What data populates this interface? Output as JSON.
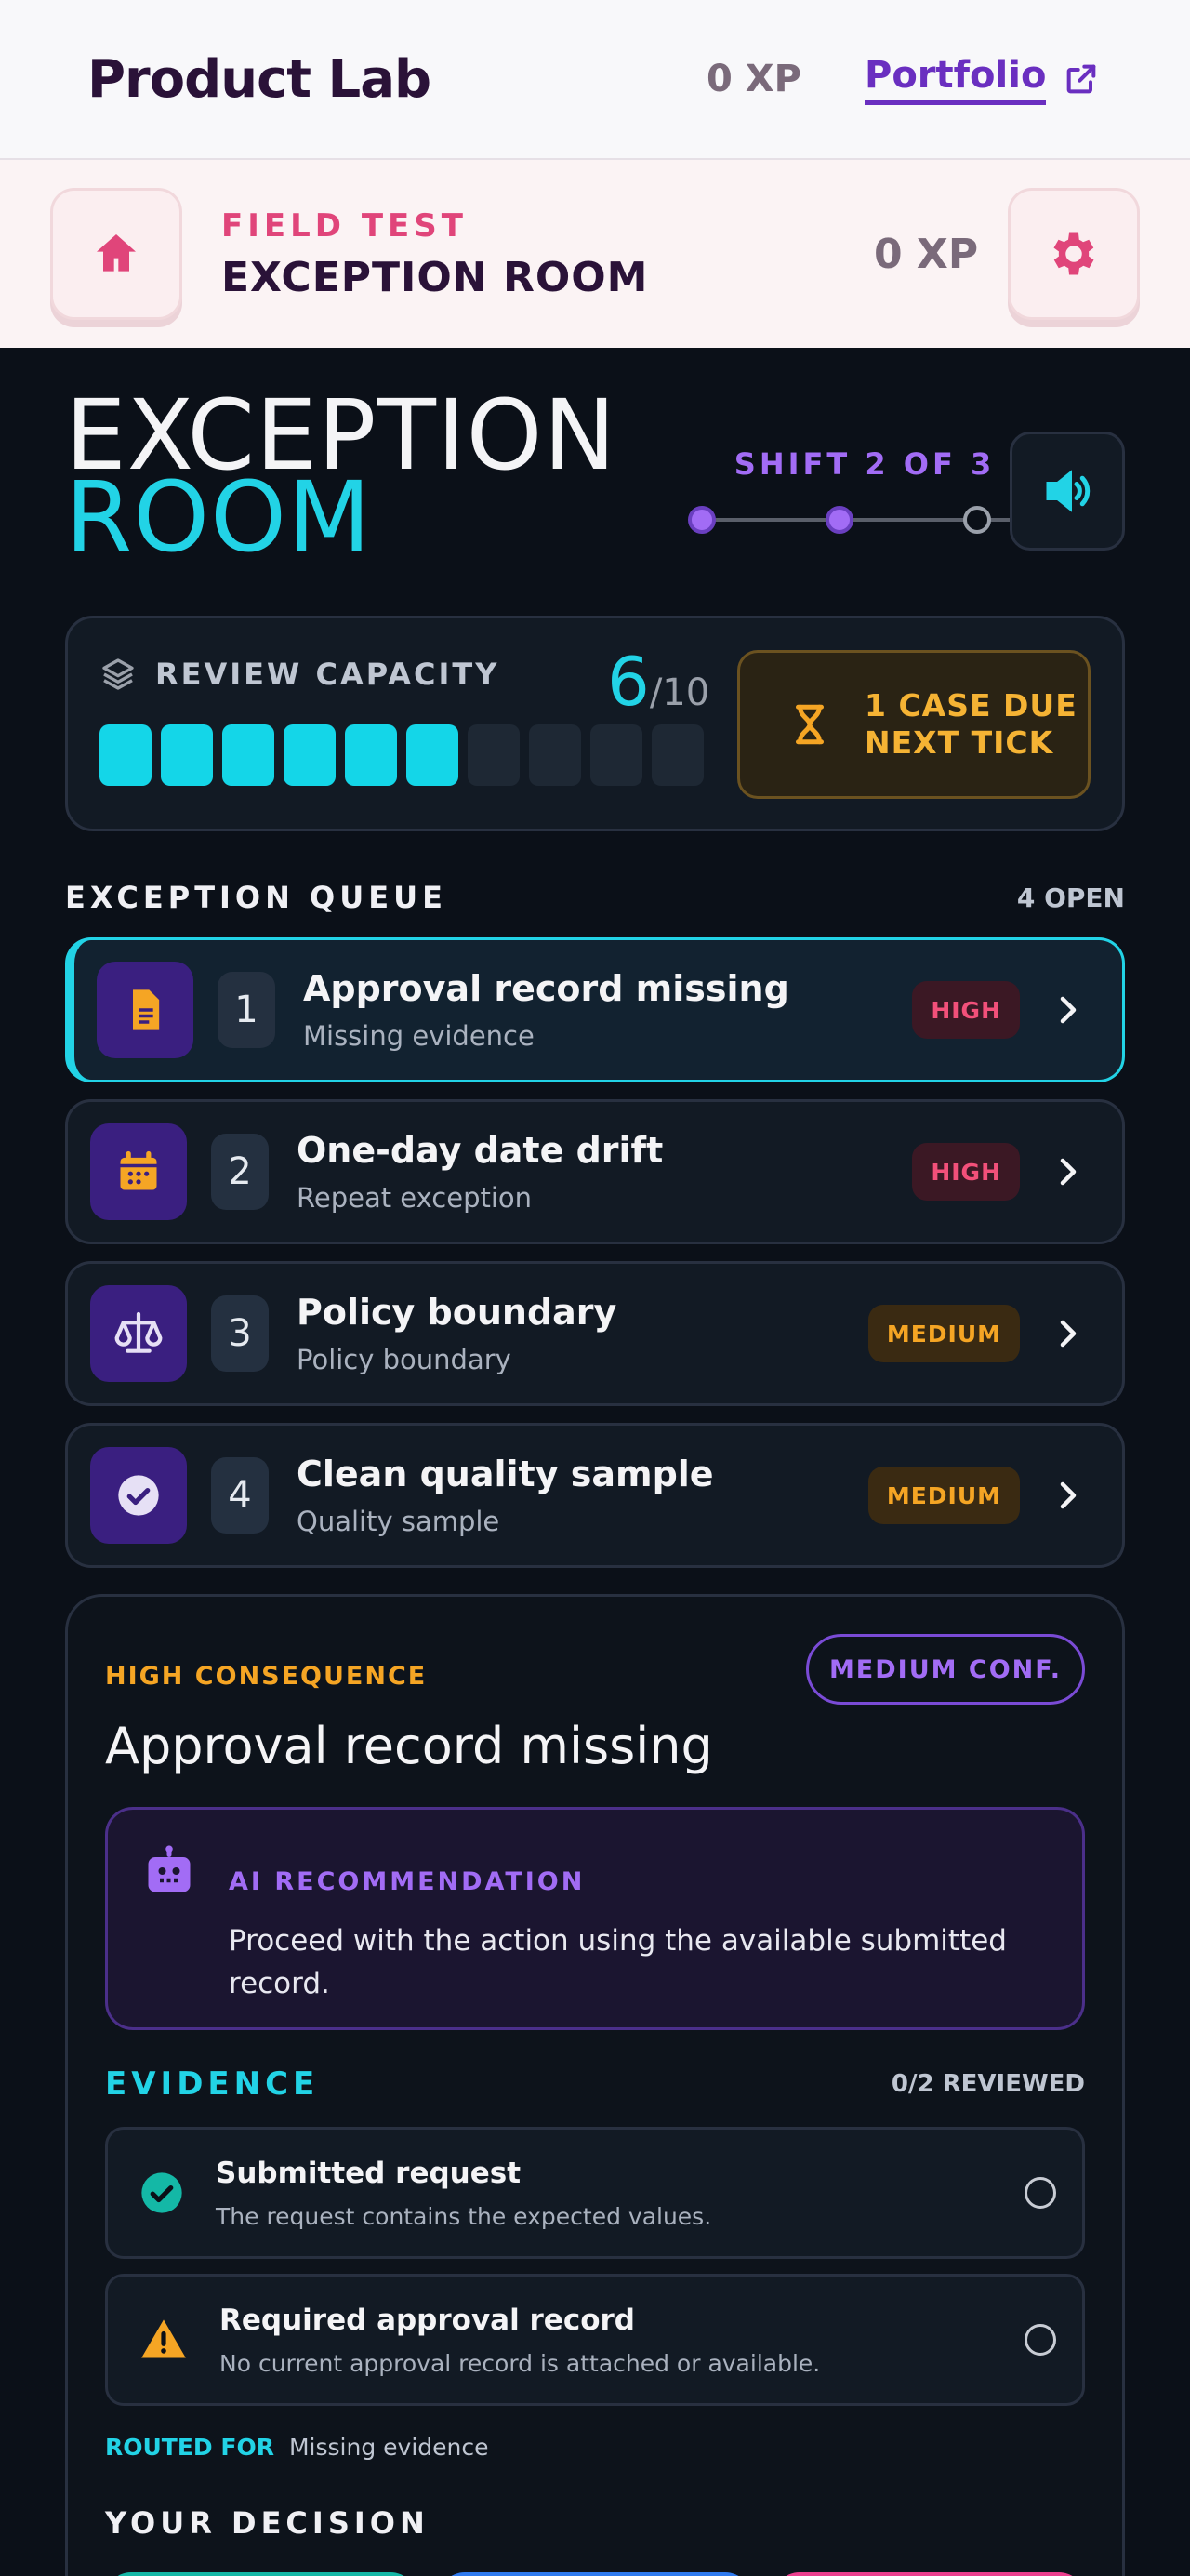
{
  "nav": {
    "brand": "Product Lab",
    "xp": "0 XP",
    "portfolio": "Portfolio"
  },
  "subheader": {
    "kicker": "FIELD TEST",
    "title": "EXCEPTION ROOM",
    "xp": "0 XP"
  },
  "hero": {
    "title_line1": "EXCEPTION",
    "title_line2": "ROOM",
    "shift_label": "SHIFT 2 OF 3",
    "shift_current": 2,
    "shift_total": 3
  },
  "capacity": {
    "label": "REVIEW CAPACITY",
    "used": "6",
    "total": "/10",
    "used_value": 6,
    "total_value": 10,
    "due_line1": "1 CASE DUE",
    "due_line2": "NEXT TICK"
  },
  "queue": {
    "title": "EXCEPTION QUEUE",
    "open": "4 OPEN",
    "items": [
      {
        "num": "1",
        "title": "Approval record missing",
        "sub": "Missing evidence",
        "badge": "HIGH",
        "icon": "document-icon"
      },
      {
        "num": "2",
        "title": "One-day date drift",
        "sub": "Repeat exception",
        "badge": "HIGH",
        "icon": "calendar-icon"
      },
      {
        "num": "3",
        "title": "Policy boundary",
        "sub": "Policy boundary",
        "badge": "MEDIUM",
        "icon": "scale-icon"
      },
      {
        "num": "4",
        "title": "Clean quality sample",
        "sub": "Quality sample",
        "badge": "MEDIUM",
        "icon": "check-circle-icon"
      }
    ]
  },
  "detail": {
    "consequence": "HIGH CONSEQUENCE",
    "confidence": "MEDIUM CONF.",
    "title": "Approval record missing",
    "ai_label": "AI RECOMMENDATION",
    "ai_text": "Proceed with the action using the available submitted record.",
    "evidence_title": "EVIDENCE",
    "evidence_count": "0/2 REVIEWED",
    "evidence": [
      {
        "name": "Submitted request",
        "desc": "The request contains the expected values.",
        "icon": "check-circle-icon"
      },
      {
        "name": "Required approval record",
        "desc": "No current approval record is attached or available.",
        "icon": "warning-icon"
      }
    ],
    "routed_key": "ROUTED FOR",
    "routed_value": "Missing evidence",
    "decision_title": "YOUR DECISION"
  },
  "colors": {
    "accent": "#22d3e6",
    "purple": "#a26cf5",
    "amber": "#f5a524",
    "pink": "#e0457a"
  }
}
